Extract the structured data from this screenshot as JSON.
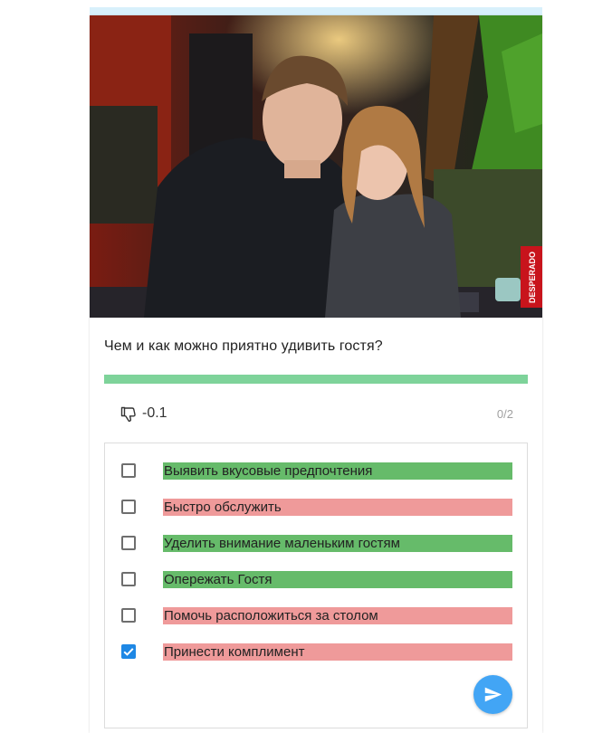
{
  "question": {
    "text": "Чем и как можно приятно удивить гостя?"
  },
  "progress": {
    "fraction": 1.0,
    "track_color": "#d2f0dc",
    "fill_color": "#7ed39a"
  },
  "score": {
    "icon": "thumbs-down-icon",
    "value": "-0.1",
    "counter": "0/2"
  },
  "options": [
    {
      "label": "Выявить вкусовые предпочтения",
      "checked": false,
      "status": "correct",
      "color": "#66bb6a"
    },
    {
      "label": "Быстро обслужить",
      "checked": false,
      "status": "incorrect",
      "color": "#ef9a9a"
    },
    {
      "label": "Уделить внимание маленьким гостям",
      "checked": false,
      "status": "correct",
      "color": "#66bb6a"
    },
    {
      "label": "Опережать Гостя",
      "checked": false,
      "status": "correct",
      "color": "#66bb6a"
    },
    {
      "label": "Помочь расположиться за столом",
      "checked": false,
      "status": "incorrect",
      "color": "#ef9a9a"
    },
    {
      "label": "Принести комплимент",
      "checked": true,
      "status": "incorrect",
      "color": "#ef9a9a"
    }
  ],
  "photo": {
    "sign_text": "DESPERADO"
  },
  "send": {
    "icon": "send-icon",
    "color": "#42a5f5"
  }
}
